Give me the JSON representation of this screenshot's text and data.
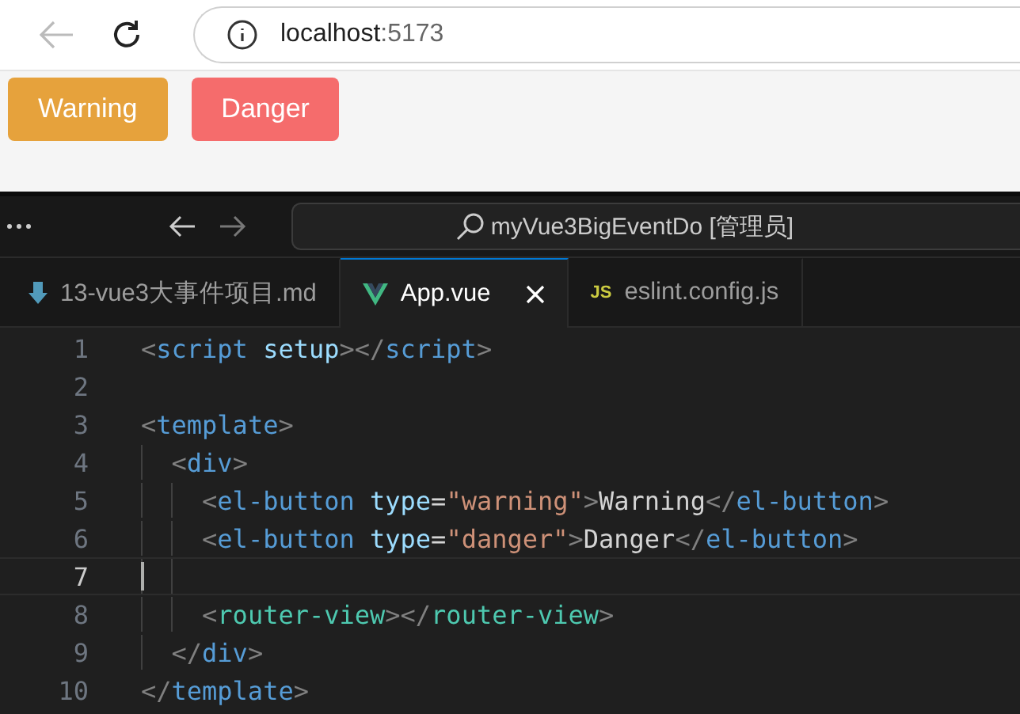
{
  "browser": {
    "url_host": "localhost",
    "url_port": ":5173"
  },
  "page": {
    "buttons": [
      {
        "label": "Warning",
        "kind": "warning"
      },
      {
        "label": "Danger",
        "kind": "danger"
      }
    ]
  },
  "editor": {
    "title": "myVue3BigEventDo [管理员]",
    "tabs": [
      {
        "label": "13-vue3大事件项目.md",
        "kind": "markdown",
        "selected": false
      },
      {
        "label": "App.vue",
        "kind": "vue",
        "selected": true
      },
      {
        "label": "eslint.config.js",
        "kind": "js",
        "selected": false
      }
    ],
    "js_badge": "JS",
    "lines": [
      {
        "number": "1",
        "current": false,
        "tokens": [
          {
            "kind": "punct",
            "text": "<"
          },
          {
            "kind": "tag",
            "text": "script"
          },
          {
            "kind": "attr",
            "text": " setup"
          },
          {
            "kind": "punct",
            "text": "></"
          },
          {
            "kind": "tag",
            "text": "script"
          },
          {
            "kind": "punct",
            "text": ">"
          }
        ]
      },
      {
        "number": "2",
        "current": false
      },
      {
        "number": "3",
        "current": false,
        "tokens": [
          {
            "kind": "punct",
            "text": "<"
          },
          {
            "kind": "tag",
            "text": "template"
          },
          {
            "kind": "punct",
            "text": ">"
          }
        ]
      },
      {
        "number": "4",
        "current": false,
        "tokens": [
          {
            "kind": "punct",
            "text": "  <"
          },
          {
            "kind": "tag",
            "text": "div"
          },
          {
            "kind": "punct",
            "text": ">"
          }
        ]
      },
      {
        "number": "5",
        "current": false,
        "tokens": [
          {
            "kind": "punct",
            "text": "    <"
          },
          {
            "kind": "tag",
            "text": "el-button"
          },
          {
            "kind": "attr",
            "text": " type"
          },
          {
            "kind": "text",
            "text": "="
          },
          {
            "kind": "string",
            "text": "\"warning\""
          },
          {
            "kind": "punct",
            "text": ">"
          },
          {
            "kind": "text",
            "text": "Warning"
          },
          {
            "kind": "punct",
            "text": "</"
          },
          {
            "kind": "tag",
            "text": "el-button"
          },
          {
            "kind": "punct",
            "text": ">"
          }
        ]
      },
      {
        "number": "6",
        "current": false,
        "tokens": [
          {
            "kind": "punct",
            "text": "    <"
          },
          {
            "kind": "tag",
            "text": "el-button"
          },
          {
            "kind": "attr",
            "text": " type"
          },
          {
            "kind": "text",
            "text": "="
          },
          {
            "kind": "string",
            "text": "\"danger\""
          },
          {
            "kind": "punct",
            "text": ">"
          },
          {
            "kind": "text",
            "text": "Danger"
          },
          {
            "kind": "punct",
            "text": "</"
          },
          {
            "kind": "tag",
            "text": "el-button"
          },
          {
            "kind": "punct",
            "text": ">"
          }
        ]
      },
      {
        "number": "7",
        "current": true
      },
      {
        "number": "8",
        "current": false,
        "tokens": [
          {
            "kind": "punct",
            "text": "    <"
          },
          {
            "kind": "component",
            "text": "router-view"
          },
          {
            "kind": "punct",
            "text": "></"
          },
          {
            "kind": "component",
            "text": "router-view"
          },
          {
            "kind": "punct",
            "text": ">"
          }
        ]
      },
      {
        "number": "9",
        "current": false,
        "tokens": [
          {
            "kind": "punct",
            "text": "  </"
          },
          {
            "kind": "tag",
            "text": "div"
          },
          {
            "kind": "punct",
            "text": ">"
          }
        ]
      },
      {
        "number": "10",
        "current": false,
        "tokens": [
          {
            "kind": "punct",
            "text": "</"
          },
          {
            "kind": "tag",
            "text": "template"
          },
          {
            "kind": "punct",
            "text": ">"
          }
        ]
      }
    ]
  }
}
